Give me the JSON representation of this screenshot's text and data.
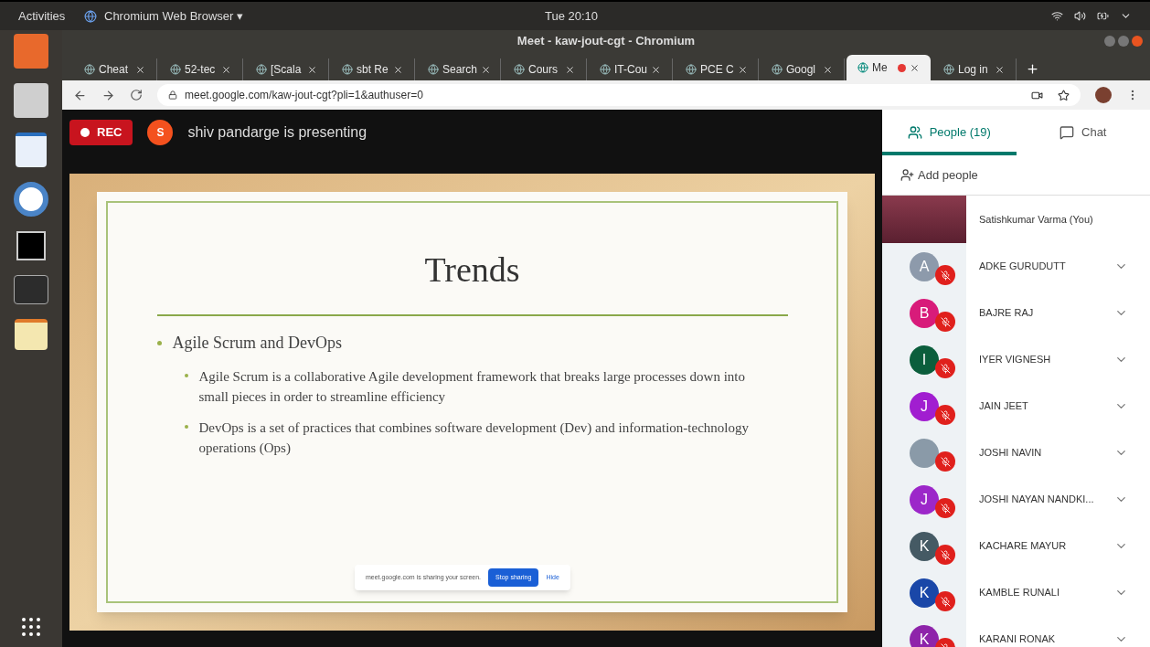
{
  "topbar": {
    "activities": "Activities",
    "app_menu": "Chromium Web Browser ▾",
    "clock": "Tue 20:10"
  },
  "window": {
    "title": "Meet - kaw-jout-cgt - Chromium"
  },
  "tabs": [
    {
      "label": "Cheat",
      "selected": false,
      "recording": false
    },
    {
      "label": "52-tec",
      "selected": false,
      "recording": false
    },
    {
      "label": "[Scala",
      "selected": false,
      "recording": false
    },
    {
      "label": "sbt Re",
      "selected": false,
      "recording": false
    },
    {
      "label": "Search",
      "selected": false,
      "recording": false
    },
    {
      "label": "Cours",
      "selected": false,
      "recording": false
    },
    {
      "label": "IT-Cou",
      "selected": false,
      "recording": false
    },
    {
      "label": "PCE C",
      "selected": false,
      "recording": false
    },
    {
      "label": "Googl",
      "selected": false,
      "recording": false
    },
    {
      "label": "Me",
      "selected": true,
      "recording": true
    },
    {
      "label": "Log in",
      "selected": false,
      "recording": false
    }
  ],
  "address_bar": {
    "value": "meet.google.com/kaw-jout-cgt?pli=1&authuser=0"
  },
  "meet": {
    "rec": "REC",
    "presenter_initial": "S",
    "presenting": "shiv pandarge is presenting"
  },
  "slide": {
    "title": "Trends",
    "bullet": "Agile Scrum and DevOps",
    "sub_bullets": [
      "Agile Scrum is a collaborative Agile development framework that breaks large processes down into small pieces in order to streamline efficiency",
      "DevOps is a set of practices that combines software development (Dev) and information-technology operations (Ops)"
    ]
  },
  "share_bar": {
    "message": "meet.google.com is sharing your screen.",
    "stop": "Stop sharing",
    "hide": "Hide"
  },
  "panel": {
    "tabs": [
      {
        "label": "People (19)",
        "selected": true
      },
      {
        "label": "Chat",
        "selected": false
      }
    ],
    "add_people": "Add people",
    "participants": [
      {
        "kind": "video",
        "name": "Satishkumar Varma (You)",
        "muted": false
      },
      {
        "kind": "letter",
        "initial": "A",
        "color": "#8d9aab",
        "name": "ADKE GURUDUTT",
        "muted": true
      },
      {
        "kind": "letter",
        "initial": "B",
        "color": "#d81b7a",
        "name": "BAJRE RAJ",
        "muted": true
      },
      {
        "kind": "letter",
        "initial": "I",
        "color": "#0b5e3c",
        "name": "IYER VIGNESH",
        "muted": true
      },
      {
        "kind": "letter",
        "initial": "J",
        "color": "#a11ed0",
        "name": "JAIN JEET",
        "muted": true
      },
      {
        "kind": "photo",
        "name": "JOSHI NAVIN",
        "muted": true
      },
      {
        "kind": "letter",
        "initial": "J",
        "color": "#9c27c9",
        "name": "JOSHI NAYAN NANDKI...",
        "muted": true
      },
      {
        "kind": "letter",
        "initial": "K",
        "color": "#455a64",
        "name": "KACHARE MAYUR",
        "muted": true
      },
      {
        "kind": "letter",
        "initial": "K",
        "color": "#1a47a8",
        "name": "KAMBLE RUNALI",
        "muted": true
      },
      {
        "kind": "letter",
        "initial": "K",
        "color": "#8e24aa",
        "name": "KARANI RONAK",
        "muted": true
      }
    ]
  }
}
